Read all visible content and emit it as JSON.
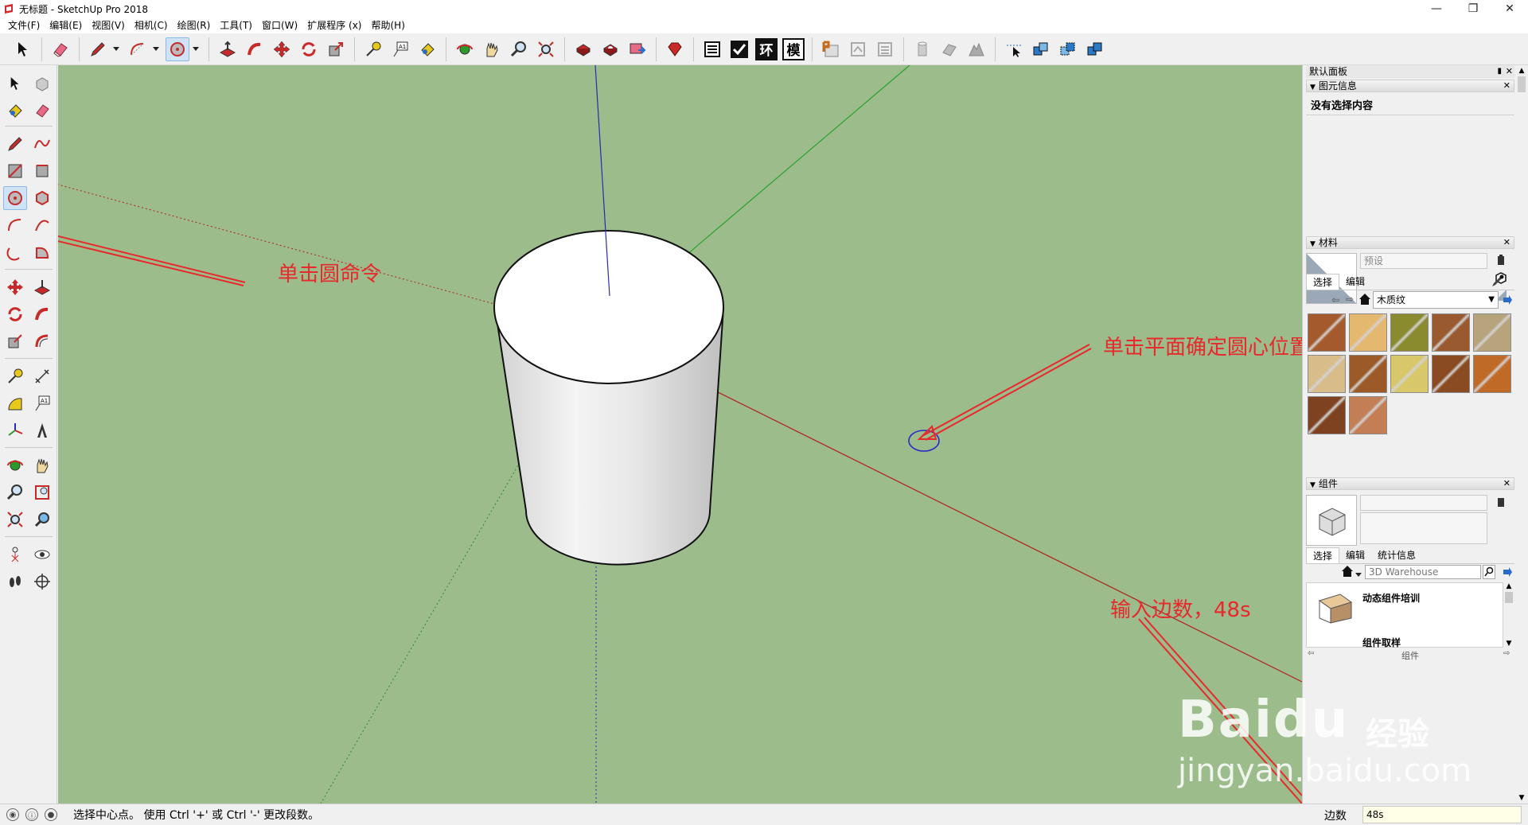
{
  "window": {
    "title": "无标题 - SketchUp Pro 2018",
    "minimize": "—",
    "maximize": "❐",
    "close": "✕"
  },
  "menu": [
    "文件(F)",
    "编辑(E)",
    "视图(V)",
    "相机(C)",
    "绘图(R)",
    "工具(T)",
    "窗口(W)",
    "扩展程序 (x)",
    "帮助(H)"
  ],
  "toolbar": {
    "text_buttons": [
      "环",
      "模"
    ],
    "icons": [
      "select-icon",
      "eraser-icon",
      "pencil-icon",
      "arc-icon",
      "circle-icon",
      "push-pull-icon",
      "follow-me-icon",
      "move-icon",
      "rotate-icon",
      "scale-icon",
      "tape-icon",
      "text-icon",
      "paint-icon",
      "orbit-icon",
      "pan-icon",
      "zoom-icon",
      "zoom-extents-icon",
      "warehouse-icon",
      "extension-warehouse-icon",
      "layout-icon",
      "ruby-icon",
      "outliner-icon",
      "checkbox-icon"
    ]
  },
  "annotations": {
    "circle_cmd": "单击圆命令",
    "click_plane": "单击平面确定圆心位置",
    "input_sides": "输入边数，48s"
  },
  "right_panel": {
    "tray_title": "默认面板",
    "entity_info": {
      "title": "图元信息",
      "empty_text": "没有选择内容"
    },
    "materials": {
      "title": "材料",
      "name_placeholder": "预设",
      "tabs": [
        "选择",
        "编辑"
      ],
      "library": "木质纹",
      "swatch_colors": [
        "#a45a2c",
        "#e5b870",
        "#8a8a2e",
        "#9a5a30",
        "#b8a47c",
        "#d8bc8a",
        "#9b5a28",
        "#d8c86a",
        "#8a4a22",
        "#c06a28",
        "#7e4220",
        "#c47e56"
      ]
    },
    "components": {
      "title": "组件",
      "tabs": [
        "选择",
        "编辑",
        "统计信息"
      ],
      "search_placeholder": "3D Warehouse",
      "items": [
        "动态组件培训",
        "组件取样"
      ],
      "footer": "组件"
    }
  },
  "status": {
    "message": "选择中心点。 使用 Ctrl '+' 或 Ctrl '-' 更改段数。",
    "vcb_label": "边数",
    "vcb_value": "48s"
  },
  "watermark": {
    "brand": "Baidu",
    "brand_cn": "经验",
    "url": "jingyan.baidu.com"
  }
}
